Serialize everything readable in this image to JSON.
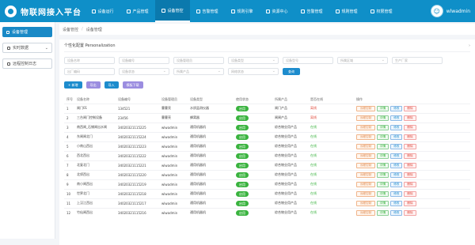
{
  "app": {
    "title": "物联网接入平台"
  },
  "nav": [
    {
      "label": "设备运行",
      "icon": "monitor-icon"
    },
    {
      "label": "产品管理",
      "icon": "box-icon"
    },
    {
      "label": "设备管控",
      "icon": "control-icon",
      "active": true
    },
    {
      "label": "告警管理",
      "icon": "alarm-icon"
    },
    {
      "label": "规则引擎",
      "icon": "rules-icon"
    },
    {
      "label": "资源中心",
      "icon": "resource-icon"
    },
    {
      "label": "告警管理",
      "icon": "alert-icon"
    },
    {
      "label": "规则管理",
      "icon": "rule-manage-icon"
    },
    {
      "label": "权限管理",
      "icon": "permission-icon"
    }
  ],
  "user": {
    "name": "wlwadmin"
  },
  "sidebar": {
    "items": [
      {
        "label": "设备管理",
        "active": true
      },
      {
        "label": "实时数据",
        "expandable": true
      },
      {
        "label": "远程控制日志"
      }
    ]
  },
  "breadcrumb": {
    "root": "设备管控",
    "current": "设备管理"
  },
  "section": {
    "title": "个性化配置 Personalization"
  },
  "filters": {
    "row1": [
      "设备名称",
      "设备编号",
      "设备管理员",
      "设备类型",
      "设备型号",
      "所属区域",
      "生产厂家"
    ],
    "row2": [
      "出厂编码",
      "设备状态",
      "所属产品",
      "网络状态"
    ],
    "search_label": "查询"
  },
  "actions": {
    "add": "+ 新增",
    "export": "导出",
    "import": "导入",
    "template": "模板下载"
  },
  "table": {
    "headers": [
      "序号",
      "设备名称",
      "设备编号",
      "设备管理员",
      "设备类型",
      "使用状态",
      "所属产品",
      "是否在线",
      "操作"
    ],
    "op_labels": {
      "control": "远程控制",
      "detail": "详情",
      "edit": "修改",
      "delete": "删除"
    },
    "rows": [
      {
        "idx": "1",
        "name": "闸门01",
        "code": "134521",
        "manager": "曹曹亮",
        "type": "水质监测仪器",
        "status": "启用",
        "product": "闸门产品",
        "online": "离线"
      },
      {
        "idx": "2",
        "name": "三台闸门控制设备",
        "code": "23456",
        "manager": "曹曹亮",
        "type": "蜂窝器",
        "status": "启用",
        "product": "闸闸产品",
        "online": "离线"
      },
      {
        "idx": "3",
        "name": "南西闸_石铺闸出水闸",
        "code": "34020321115225",
        "manager": "wlwadmin",
        "type": "通用机器机",
        "status": "启用",
        "product": "综合物业用产品",
        "online": "在线"
      },
      {
        "idx": "4",
        "name": "东闸闸北门",
        "code": "34020321115224",
        "manager": "wlwadmin",
        "type": "通用机器机",
        "status": "启用",
        "product": "综合物业用产品",
        "online": "在线"
      },
      {
        "idx": "5",
        "name": "小南山西出",
        "code": "34020321115223",
        "manager": "wlwadmin",
        "type": "通用机器机",
        "status": "启用",
        "product": "综合物业用产品",
        "online": "在线"
      },
      {
        "idx": "6",
        "name": "西北西出",
        "code": "34020321115222",
        "manager": "wlwadmin",
        "type": "通用机器机",
        "status": "启用",
        "product": "综合物业用产品",
        "online": "在线"
      },
      {
        "idx": "7",
        "name": "北复北门",
        "code": "34020321115221",
        "manager": "wlwadmin",
        "type": "通用机器机",
        "status": "启用",
        "product": "综合物业用产品",
        "online": "在线"
      },
      {
        "idx": "8",
        "name": "北郊西出",
        "code": "34020321115220",
        "manager": "wlwadmin",
        "type": "通用机器机",
        "status": "启用",
        "product": "综合物业用产品",
        "online": "在线"
      },
      {
        "idx": "9",
        "name": "南小闸西出",
        "code": "34020321115219",
        "manager": "wlwadmin",
        "type": "通用机器机",
        "status": "启用",
        "product": "综合物业用产品",
        "online": "在线"
      },
      {
        "idx": "10",
        "name": "世界北门",
        "code": "34020321115218",
        "manager": "wlwadmin",
        "type": "通用机器机",
        "status": "启用",
        "product": "综合物业用产品",
        "online": "在线"
      },
      {
        "idx": "11",
        "name": "上汉江西出",
        "code": "34020321115217",
        "manager": "wlwadmin",
        "type": "通用机器机",
        "status": "启用",
        "product": "综合物业用产品",
        "online": "在线"
      },
      {
        "idx": "12",
        "name": "竹仙闸西出",
        "code": "34020321115216",
        "manager": "wlwadmin",
        "type": "通用机器机",
        "status": "启用",
        "product": "综合物业用产品",
        "online": "在线"
      }
    ]
  },
  "colors": {
    "brand": "#0f8fc8",
    "success": "#3ab33f",
    "danger": "#e04a3b"
  }
}
